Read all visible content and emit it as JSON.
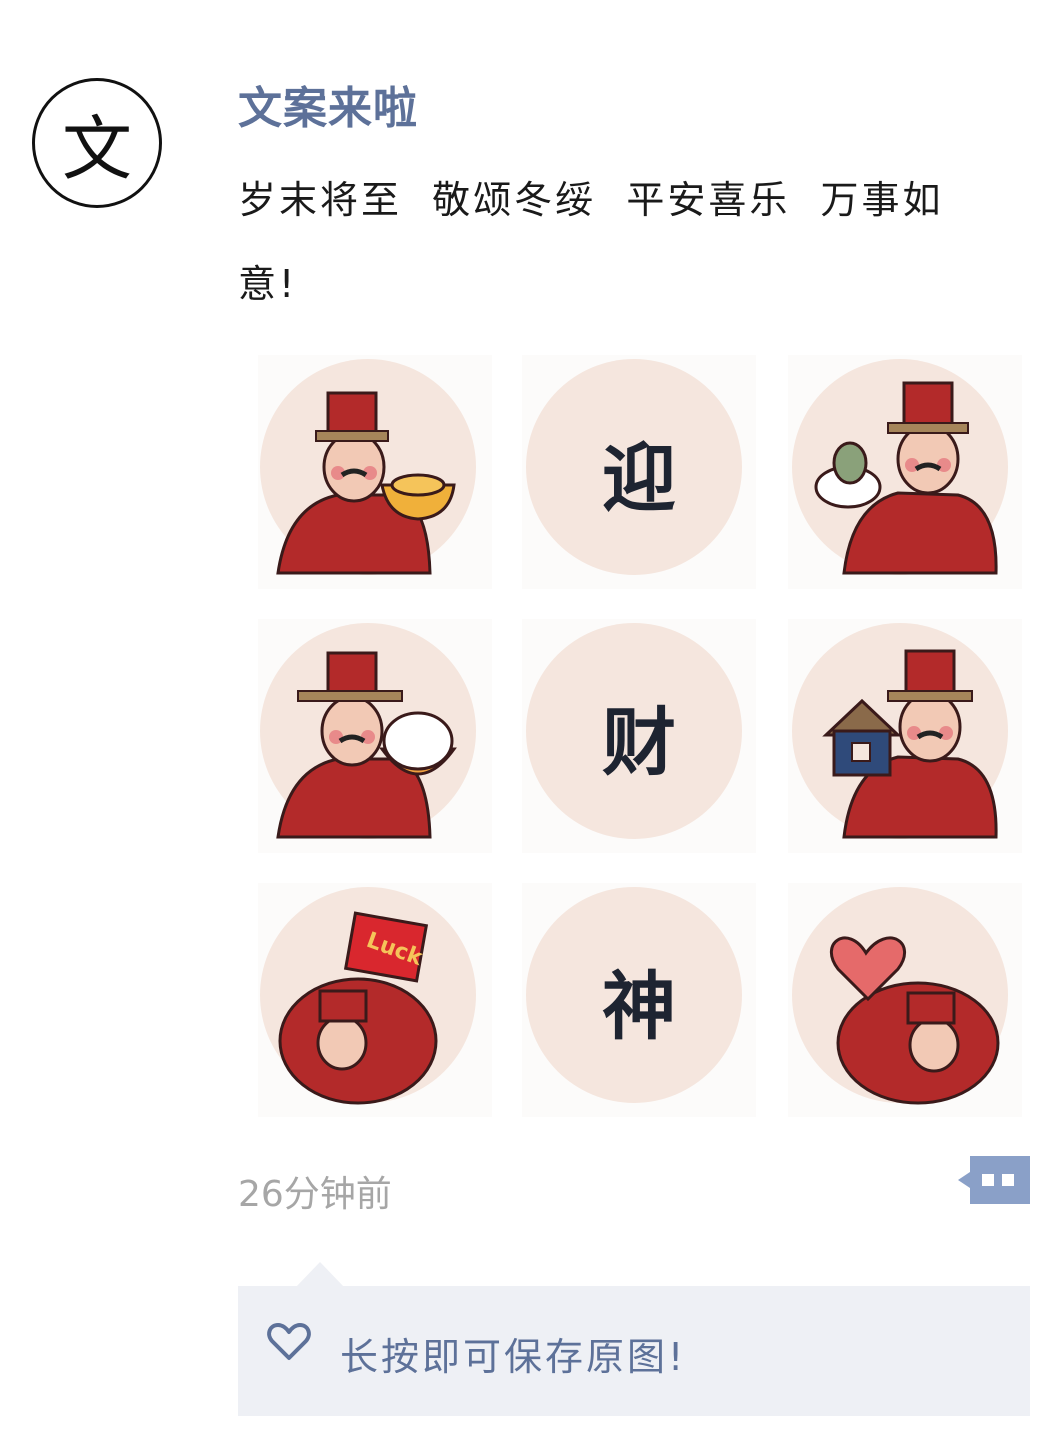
{
  "post": {
    "avatar_char": "文",
    "author": "文案来啦",
    "caption_line1": "岁末将至  敬颂冬绥  平安喜乐  万事如",
    "caption_line2": "意!",
    "time": "26分钟前"
  },
  "images": [
    {
      "kind": "figure",
      "holding": "gold-ingot"
    },
    {
      "kind": "character",
      "text": "迎"
    },
    {
      "kind": "figure",
      "holding": "sprout-bird"
    },
    {
      "kind": "figure",
      "holding": "rice-bowl"
    },
    {
      "kind": "character",
      "text": "财"
    },
    {
      "kind": "figure",
      "holding": "house"
    },
    {
      "kind": "figure",
      "holding": "luck-sign",
      "sign_text": "Luck"
    },
    {
      "kind": "character",
      "text": "神"
    },
    {
      "kind": "figure",
      "holding": "heart"
    }
  ],
  "likes": {
    "icon": "heart-outline-icon",
    "text": "长按即可保存原图!"
  },
  "colors": {
    "author": "#5d7199",
    "tile_circle": "#f5e6de",
    "robe_red": "#b32a2a",
    "time_gray": "#a6a6a6",
    "likes_bg": "#eef0f5"
  }
}
